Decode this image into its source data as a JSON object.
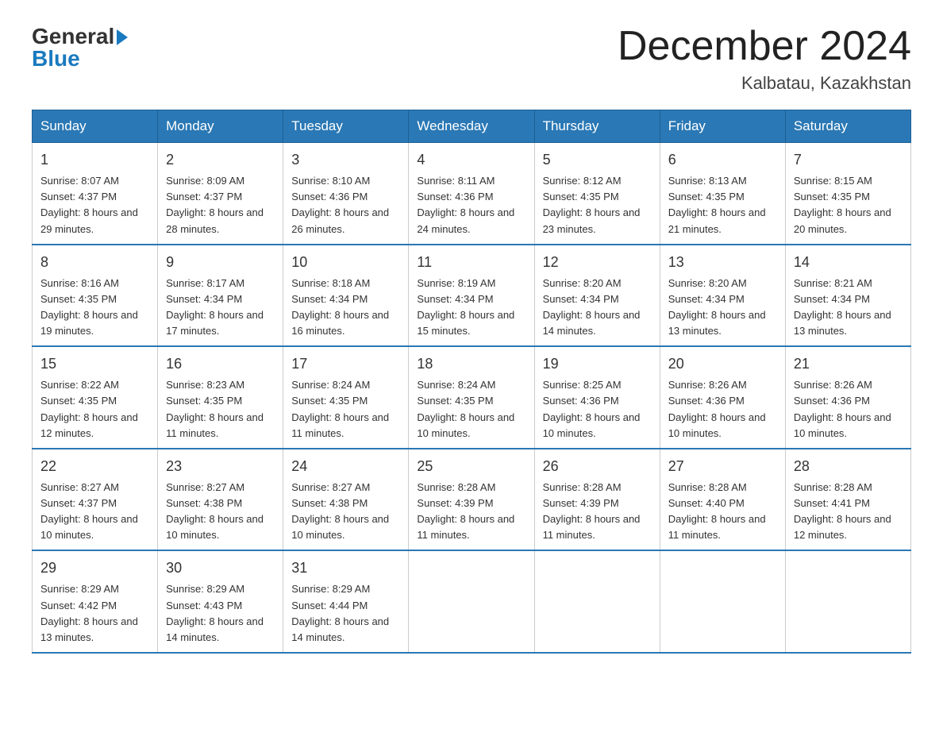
{
  "logo": {
    "general": "General",
    "blue": "Blue"
  },
  "title": "December 2024",
  "subtitle": "Kalbatau, Kazakhstan",
  "header_days": [
    "Sunday",
    "Monday",
    "Tuesday",
    "Wednesday",
    "Thursday",
    "Friday",
    "Saturday"
  ],
  "weeks": [
    [
      {
        "day": "1",
        "sunrise": "8:07 AM",
        "sunset": "4:37 PM",
        "daylight": "8 hours and 29 minutes."
      },
      {
        "day": "2",
        "sunrise": "8:09 AM",
        "sunset": "4:37 PM",
        "daylight": "8 hours and 28 minutes."
      },
      {
        "day": "3",
        "sunrise": "8:10 AM",
        "sunset": "4:36 PM",
        "daylight": "8 hours and 26 minutes."
      },
      {
        "day": "4",
        "sunrise": "8:11 AM",
        "sunset": "4:36 PM",
        "daylight": "8 hours and 24 minutes."
      },
      {
        "day": "5",
        "sunrise": "8:12 AM",
        "sunset": "4:35 PM",
        "daylight": "8 hours and 23 minutes."
      },
      {
        "day": "6",
        "sunrise": "8:13 AM",
        "sunset": "4:35 PM",
        "daylight": "8 hours and 21 minutes."
      },
      {
        "day": "7",
        "sunrise": "8:15 AM",
        "sunset": "4:35 PM",
        "daylight": "8 hours and 20 minutes."
      }
    ],
    [
      {
        "day": "8",
        "sunrise": "8:16 AM",
        "sunset": "4:35 PM",
        "daylight": "8 hours and 19 minutes."
      },
      {
        "day": "9",
        "sunrise": "8:17 AM",
        "sunset": "4:34 PM",
        "daylight": "8 hours and 17 minutes."
      },
      {
        "day": "10",
        "sunrise": "8:18 AM",
        "sunset": "4:34 PM",
        "daylight": "8 hours and 16 minutes."
      },
      {
        "day": "11",
        "sunrise": "8:19 AM",
        "sunset": "4:34 PM",
        "daylight": "8 hours and 15 minutes."
      },
      {
        "day": "12",
        "sunrise": "8:20 AM",
        "sunset": "4:34 PM",
        "daylight": "8 hours and 14 minutes."
      },
      {
        "day": "13",
        "sunrise": "8:20 AM",
        "sunset": "4:34 PM",
        "daylight": "8 hours and 13 minutes."
      },
      {
        "day": "14",
        "sunrise": "8:21 AM",
        "sunset": "4:34 PM",
        "daylight": "8 hours and 13 minutes."
      }
    ],
    [
      {
        "day": "15",
        "sunrise": "8:22 AM",
        "sunset": "4:35 PM",
        "daylight": "8 hours and 12 minutes."
      },
      {
        "day": "16",
        "sunrise": "8:23 AM",
        "sunset": "4:35 PM",
        "daylight": "8 hours and 11 minutes."
      },
      {
        "day": "17",
        "sunrise": "8:24 AM",
        "sunset": "4:35 PM",
        "daylight": "8 hours and 11 minutes."
      },
      {
        "day": "18",
        "sunrise": "8:24 AM",
        "sunset": "4:35 PM",
        "daylight": "8 hours and 10 minutes."
      },
      {
        "day": "19",
        "sunrise": "8:25 AM",
        "sunset": "4:36 PM",
        "daylight": "8 hours and 10 minutes."
      },
      {
        "day": "20",
        "sunrise": "8:26 AM",
        "sunset": "4:36 PM",
        "daylight": "8 hours and 10 minutes."
      },
      {
        "day": "21",
        "sunrise": "8:26 AM",
        "sunset": "4:36 PM",
        "daylight": "8 hours and 10 minutes."
      }
    ],
    [
      {
        "day": "22",
        "sunrise": "8:27 AM",
        "sunset": "4:37 PM",
        "daylight": "8 hours and 10 minutes."
      },
      {
        "day": "23",
        "sunrise": "8:27 AM",
        "sunset": "4:38 PM",
        "daylight": "8 hours and 10 minutes."
      },
      {
        "day": "24",
        "sunrise": "8:27 AM",
        "sunset": "4:38 PM",
        "daylight": "8 hours and 10 minutes."
      },
      {
        "day": "25",
        "sunrise": "8:28 AM",
        "sunset": "4:39 PM",
        "daylight": "8 hours and 11 minutes."
      },
      {
        "day": "26",
        "sunrise": "8:28 AM",
        "sunset": "4:39 PM",
        "daylight": "8 hours and 11 minutes."
      },
      {
        "day": "27",
        "sunrise": "8:28 AM",
        "sunset": "4:40 PM",
        "daylight": "8 hours and 11 minutes."
      },
      {
        "day": "28",
        "sunrise": "8:28 AM",
        "sunset": "4:41 PM",
        "daylight": "8 hours and 12 minutes."
      }
    ],
    [
      {
        "day": "29",
        "sunrise": "8:29 AM",
        "sunset": "4:42 PM",
        "daylight": "8 hours and 13 minutes."
      },
      {
        "day": "30",
        "sunrise": "8:29 AM",
        "sunset": "4:43 PM",
        "daylight": "8 hours and 14 minutes."
      },
      {
        "day": "31",
        "sunrise": "8:29 AM",
        "sunset": "4:44 PM",
        "daylight": "8 hours and 14 minutes."
      },
      null,
      null,
      null,
      null
    ]
  ],
  "labels": {
    "sunrise_prefix": "Sunrise: ",
    "sunset_prefix": "Sunset: ",
    "daylight_prefix": "Daylight: "
  }
}
